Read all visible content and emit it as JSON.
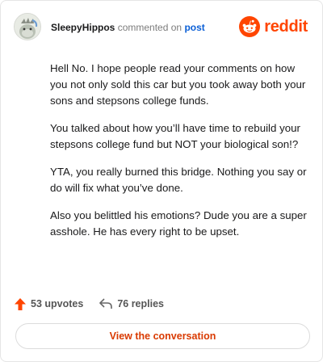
{
  "header": {
    "username": "SleepyHippos",
    "action_text": "commented on",
    "target_text": "post",
    "brand": "reddit",
    "avatar_icon": "hippo-avatar-icon",
    "brand_icon": "reddit-snoo-icon"
  },
  "comment": {
    "paragraphs": [
      "Hell No. I hope people read your comments on how you not only sold this car but you took away both your sons and stepsons college funds.",
      "You talked about how you’ll have time to rebuild your stepsons college fund but NOT your biological son!?",
      "YTA, you really burned this bridge. Nothing you say or do will fix what you’ve done.",
      "Also you belittled his emotions? Dude you are a super asshole. He has every right to be upset."
    ]
  },
  "footer": {
    "upvotes": "53 upvotes",
    "replies": "76 replies",
    "upvote_icon": "upvote-arrow-icon",
    "reply_icon": "reply-arrow-icon"
  },
  "cta": {
    "label": "View the conversation"
  },
  "colors": {
    "brand": "#ff4500",
    "link": "#0b5fd6",
    "cta_text": "#d93a00"
  }
}
